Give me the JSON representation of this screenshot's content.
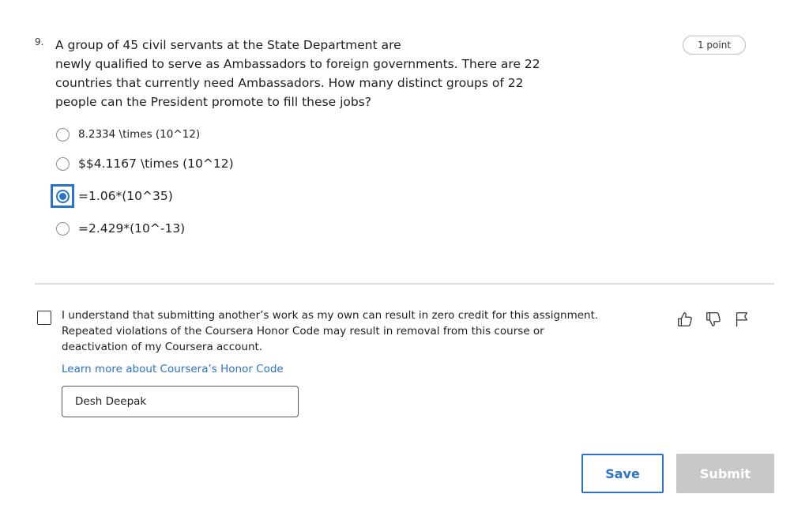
{
  "question": {
    "number": "9.",
    "text_lines": [
      "A group of 45 civil servants at the State Department are",
      "newly qualified to serve as Ambassadors to foreign governments. There are 22",
      "countries that currently need Ambassadors. How many distinct groups of 22",
      "people can the President promote to fill these jobs?"
    ],
    "points": "1 point",
    "options": [
      {
        "label": "8.2334 \\times (10^12)",
        "selected": false
      },
      {
        "label": "$$4.1167 \\times (10^12)",
        "selected": false
      },
      {
        "label": "=1.06*(10^35)",
        "selected": true
      },
      {
        "label": "=2.429*(10^-13)",
        "selected": false
      }
    ]
  },
  "honor_code": {
    "checked": false,
    "text_lines": [
      "I understand that submitting another’s work as my own can result in zero credit for this assignment.",
      "Repeated violations of the Coursera Honor Code may result in removal from this course or",
      "deactivation of my Coursera account."
    ],
    "link": "Learn more about Coursera’s Honor Code",
    "name_value": "Desh Deepak"
  },
  "feedback": {
    "icons": [
      "thumbs-up-icon",
      "thumbs-down-icon",
      "flag-icon"
    ]
  },
  "actions": {
    "save_label": "Save",
    "submit_label": "Submit"
  },
  "colors": {
    "accent": "#2a73cc",
    "submit_disabled": "#c8c8c8",
    "divider": "#dcdcdc"
  }
}
